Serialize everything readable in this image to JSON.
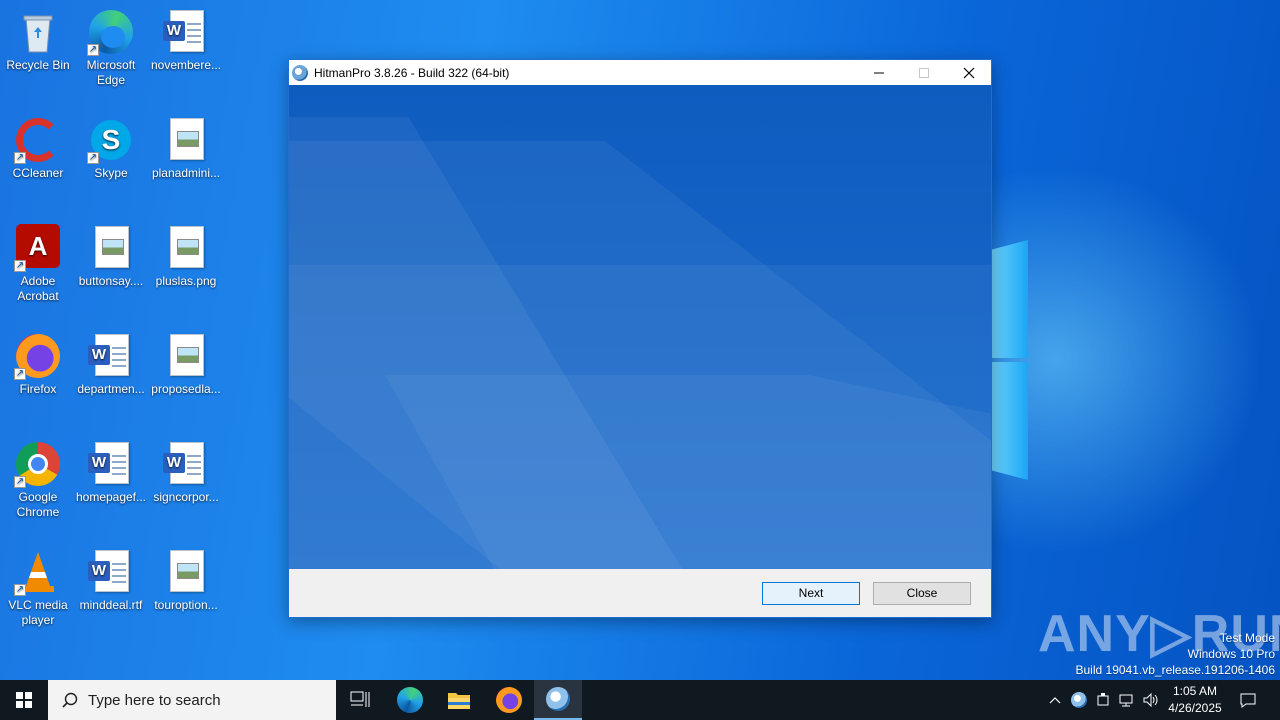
{
  "desktop": {
    "icons": [
      {
        "label": "Recycle Bin"
      },
      {
        "label": "Microsoft Edge"
      },
      {
        "label": "novembere..."
      },
      {
        "label": "CCleaner"
      },
      {
        "label": "Skype"
      },
      {
        "label": "planadmini..."
      },
      {
        "label": "Adobe Acrobat"
      },
      {
        "label": "buttonsay...."
      },
      {
        "label": "pluslas.png"
      },
      {
        "label": "Firefox"
      },
      {
        "label": "departmen..."
      },
      {
        "label": "proposedla..."
      },
      {
        "label": "Google Chrome"
      },
      {
        "label": "homepagef..."
      },
      {
        "label": "signcorpor..."
      },
      {
        "label": "VLC media player"
      },
      {
        "label": "minddeal.rtf"
      },
      {
        "label": "touroption..."
      }
    ]
  },
  "window": {
    "title": "HitmanPro 3.8.26 - Build 322 (64-bit)",
    "next_label": "Next",
    "close_label": "Close"
  },
  "watermark": {
    "logo_text": "ANY RUN",
    "test_mode": "Test Mode",
    "edition": "Windows 10 Pro",
    "build": "Build 19041.vb_release.191206-1406"
  },
  "taskbar": {
    "search_placeholder": "Type here to search",
    "time": "1:05 AM",
    "date": "4/26/2025"
  },
  "colors": {
    "accent": "#0078d7",
    "banner": "#1565c8",
    "taskbar": "#101820"
  }
}
